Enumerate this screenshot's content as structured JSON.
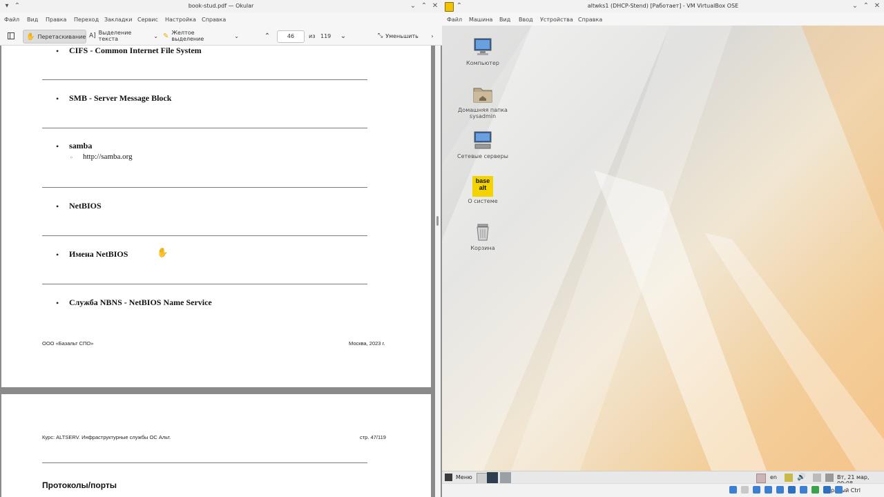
{
  "okular": {
    "window_title": "book-stud.pdf — Okular",
    "menu": [
      "Файл",
      "Вид",
      "Правка",
      "Переход",
      "Закладки",
      "Сервис",
      "Настройка",
      "Справка"
    ],
    "toolbar": {
      "browse_label": "Перетаскивание",
      "text_select_label": "Выделение текста",
      "highlight_label": "Желтое выделение",
      "page_current": "46",
      "page_of": "из",
      "page_total": "119",
      "zoom_out_label": "Уменьшить"
    },
    "page1": {
      "items": [
        "CIFS - Common Internet File System",
        "SMB - Server Message Block",
        "samba",
        "NetBIOS",
        "Имена NetBIOS",
        "Служба NBNS - NetBIOS Name Service"
      ],
      "subitem": "http://samba.org",
      "footer_left": "ООО «Базальт СПО»",
      "footer_right": "Москва, 2023 г."
    },
    "page2": {
      "header_left": "Курс: ALTSERV. Инфраструктурные службы ОС Альт.",
      "header_right": "стр. 47/119",
      "heading": "Протоколы/порты"
    }
  },
  "vbox": {
    "window_title": "altwks1 (DHCP-Stend) [Работает] - VM VirtualBox OSE",
    "menu": [
      "Файл",
      "Машина",
      "Вид",
      "Ввод",
      "Устройства",
      "Справка"
    ],
    "desktop_icons": [
      {
        "label": "Компьютер",
        "icon": "computer-icon"
      },
      {
        "label": "Домашняя папка sysadmin",
        "icon": "home-folder-icon"
      },
      {
        "label": "Сетевые серверы",
        "icon": "network-servers-icon"
      },
      {
        "label": "О системе",
        "icon": "basealt-logo-icon"
      },
      {
        "label": "Корзина",
        "icon": "trash-icon"
      }
    ],
    "taskbar": {
      "menu_label": "Меню",
      "lang": "en",
      "clock": "Вт, 21 мар, 09:08"
    },
    "host_key": "Правый Ctrl"
  }
}
